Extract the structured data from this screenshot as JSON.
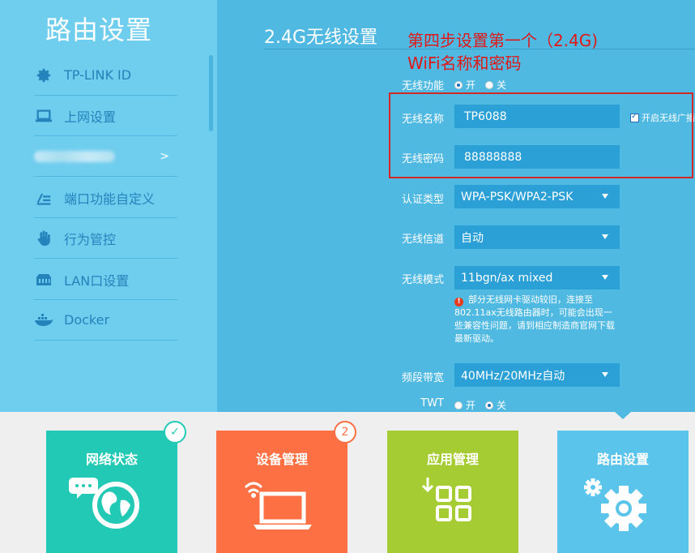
{
  "sidebar": {
    "title": "路由设置",
    "items": [
      {
        "label": "TP-LINK ID",
        "icon": "gear-icon"
      },
      {
        "label": "上网设置",
        "icon": "laptop-icon"
      },
      {
        "label": "",
        "icon": "",
        "arrow": ">"
      },
      {
        "label": "端口功能自定义",
        "icon": "edit-list-icon"
      },
      {
        "label": "行为管控",
        "icon": "hand-icon"
      },
      {
        "label": "LAN口设置",
        "icon": "network-port-icon"
      },
      {
        "label": "Docker",
        "icon": "docker-icon"
      }
    ]
  },
  "main": {
    "title": "2.4G无线设置",
    "annotation_line1": "第四步设置第一个（2.4G)",
    "annotation_line2": "WiFi名称和密码",
    "wireless_function": {
      "label": "无线功能",
      "on": "开",
      "off": "关",
      "selected": "on"
    },
    "ssid": {
      "label": "无线名称",
      "value": "TP6088",
      "broadcast_label": "开启无线广播",
      "broadcast_checked": true
    },
    "password": {
      "label": "无线密码",
      "value": "88888888"
    },
    "auth": {
      "label": "认证类型",
      "value": "WPA-PSK/WPA2-PSK"
    },
    "channel": {
      "label": "无线信道",
      "value": "自动"
    },
    "mode": {
      "label": "无线模式",
      "value": "11bgn/ax mixed"
    },
    "warning": "部分无线网卡驱动较旧，连接至802.11ax无线路由器时，可能会出现一些兼容性问题，请到相应制造商官网下载最新驱动。",
    "bandwidth": {
      "label": "频段带宽",
      "value": "40MHz/20MHz自动"
    },
    "twt": {
      "label": "TWT",
      "on": "开",
      "off": "关",
      "selected": "off"
    }
  },
  "bottom_tiles": [
    {
      "label": "网络状态",
      "color": "#22c9b5",
      "badge": "✓"
    },
    {
      "label": "设备管理",
      "color": "#fc7043",
      "badge": "2"
    },
    {
      "label": "应用管理",
      "color": "#a6cc33",
      "badge": ""
    },
    {
      "label": "路由设置",
      "color": "#5ac4ea",
      "badge": ""
    }
  ],
  "colors": {
    "sidebar": "#6fcdee",
    "main": "#4fb9e2",
    "field": "#2ba0d6",
    "annotation": "#e01818"
  }
}
